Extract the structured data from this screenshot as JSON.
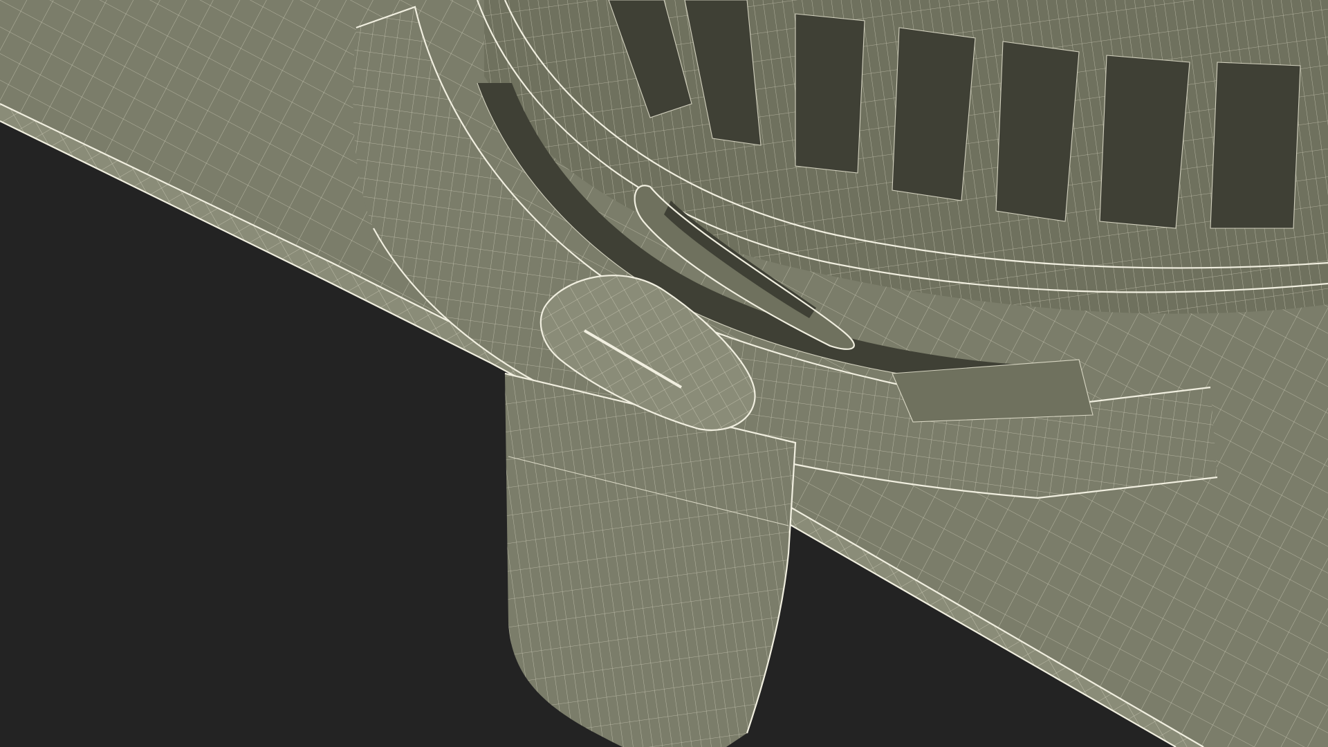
{
  "scene": {
    "subject": "wireframe-3d-model-render",
    "colors": {
      "background": "#232323",
      "surface": "#7b7d6a",
      "surface_light": "#8a8c78",
      "surface_dark": "#5e604f",
      "recess": "#3f4035",
      "wire": "#e9e6d3"
    }
  }
}
